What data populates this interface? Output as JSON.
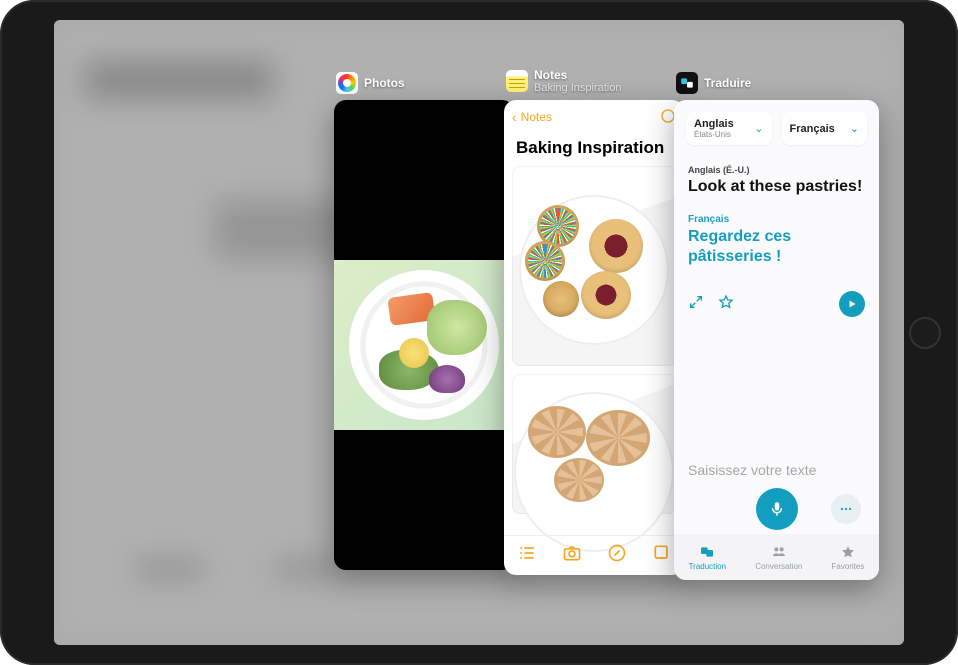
{
  "apps": {
    "photos": {
      "name": "Photos"
    },
    "notes": {
      "name": "Notes",
      "subtitle": "Baking Inspiration",
      "back_label": "Notes",
      "note_title": "Baking Inspiration"
    },
    "translate": {
      "name": "Traduire",
      "source": {
        "lang": "Anglais",
        "region": "États-Unis"
      },
      "target": {
        "lang": "Français"
      },
      "source_label": "Anglais (É.-U.)",
      "source_text": "Look at these pastries!",
      "target_label": "Français",
      "target_text": "Regardez ces pâtisseries !",
      "input_placeholder": "Saisissez votre texte",
      "tabs": {
        "translation": "Traduction",
        "conversation": "Conversation",
        "favorites": "Favorites"
      }
    }
  }
}
